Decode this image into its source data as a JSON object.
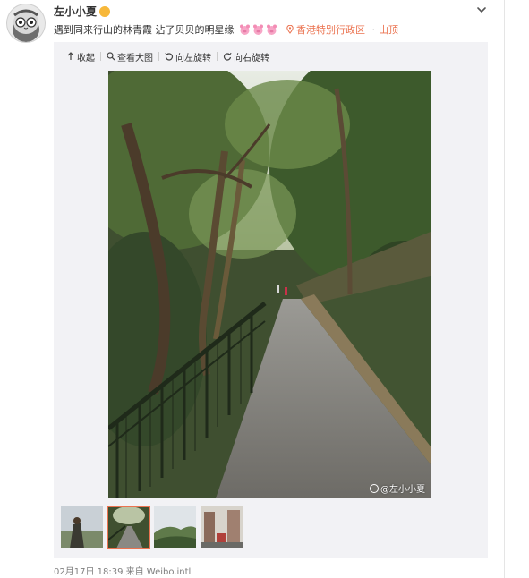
{
  "post": {
    "username": "左小小夏",
    "text": "遇到同来行山的林青霞 沾了贝贝的明星缘",
    "location_main": "香港特别行政区",
    "location_sep": "·",
    "location_sub": "山顶",
    "footer": "02月17日 18:39 来自 Weibo.intl"
  },
  "toolbar": {
    "collapse": "收起",
    "view_large": "查看大图",
    "rotate_left": "向左旋转",
    "rotate_right": "向右旋转"
  },
  "photo": {
    "watermark": "@左小小夏"
  },
  "thumbnails": {
    "count": 4,
    "active_index": 1
  },
  "colors": {
    "accent": "#eb7350",
    "media_bg": "#f2f2f5"
  }
}
